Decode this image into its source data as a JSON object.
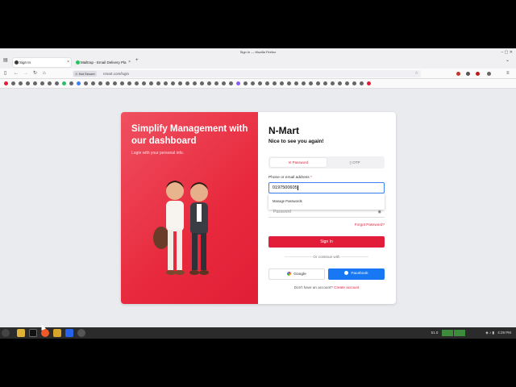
{
  "window": {
    "title": "Sign In — Mozilla Firefox"
  },
  "tabs": [
    {
      "label": "Sign In",
      "active": true
    },
    {
      "label": "Mailtrap - Email Delivery Pla",
      "active": false
    }
  ],
  "urlbar": {
    "security": "Not Secure",
    "url": "nmart.com/login"
  },
  "hero": {
    "heading": "Simplify Management with our dashboard",
    "subtext": "Login with your personal info."
  },
  "login": {
    "brand": "N-Mart",
    "greeting": "Nice to see you again!",
    "tab_password": "Password",
    "tab_otp": "OTP",
    "phone_label": "Phone or email address",
    "required_mark": "*",
    "phone_value": "0197500605",
    "autocomplete_item": "Manage Passwords",
    "password_placeholder": "Password",
    "forgot": "Forgot Password?",
    "signin": "Sign In",
    "or_continue": "Or continue with",
    "google": "Google",
    "facebook": "Facebook",
    "no_account": "Don't have an account?",
    "create_account": "Create account"
  },
  "taskbar": {
    "volume": "51.0",
    "clock": "4:29 PM"
  },
  "colors": {
    "accent": "#e11d3a",
    "facebook": "#1877f2",
    "focus": "#3b82f6"
  }
}
